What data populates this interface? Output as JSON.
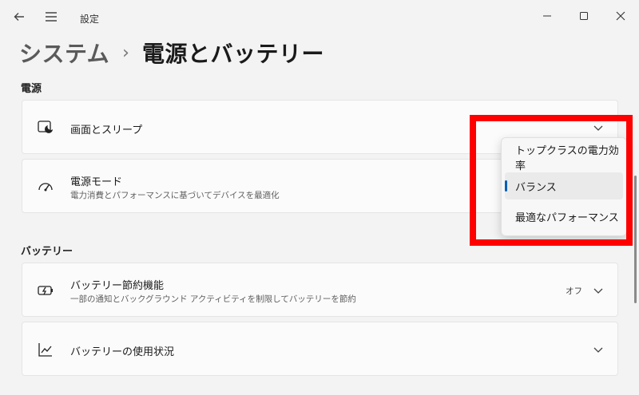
{
  "app": {
    "title": "設定"
  },
  "breadcrumb": {
    "parent": "システム",
    "separator": "›",
    "current": "電源とバッテリー"
  },
  "power_section": {
    "title": "電源",
    "screen_sleep": {
      "label": "画面とスリープ",
      "icon": "screen-sleep-icon"
    },
    "power_mode": {
      "label": "電源モード",
      "description": "電力消費とパフォーマンスに基づいてデバイスを最適化",
      "icon": "power-mode-icon"
    }
  },
  "battery_section": {
    "title": "バッテリー",
    "battery_saver": {
      "label": "バッテリー節約機能",
      "description": "一部の通知とバックグラウンド アクティビティを制限してバッテリーを節約",
      "state": "オフ",
      "icon": "battery-saver-icon"
    },
    "battery_usage": {
      "label": "バッテリーの使用状況",
      "icon": "usage-chart-icon"
    }
  },
  "power_mode_dropdown": {
    "options": [
      "トップクラスの電力効率",
      "バランス",
      "最適なパフォーマンス"
    ],
    "selected": "バランス"
  },
  "colors": {
    "accent": "#005fb8",
    "highlight": "#ff0000",
    "background": "#f3f3f3"
  }
}
